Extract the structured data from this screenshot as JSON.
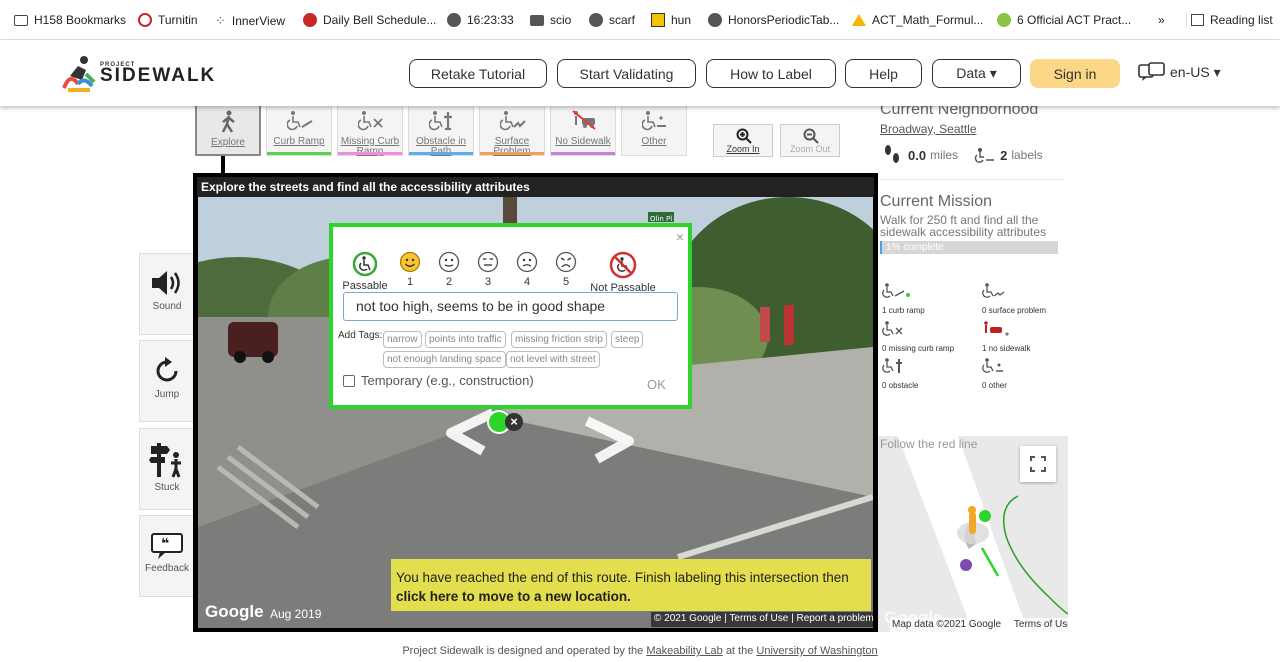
{
  "bookmarks": {
    "items": [
      {
        "label": "H158 Bookmarks",
        "icon": "folder-icon"
      },
      {
        "label": "Turnitin",
        "icon": "turnitin-icon"
      },
      {
        "label": "InnerView",
        "icon": "innerview-icon"
      },
      {
        "label": "Daily Bell Schedule...",
        "icon": "bell-schedule-icon"
      },
      {
        "label": "16:23:33",
        "icon": "globe-icon"
      },
      {
        "label": "scio",
        "icon": "folder-icon"
      },
      {
        "label": "scarf",
        "icon": "globe-icon"
      },
      {
        "label": "hun",
        "icon": "hun-icon"
      },
      {
        "label": "HonorsPeriodicTab...",
        "icon": "globe-icon"
      },
      {
        "label": "ACT_Math_Formul...",
        "icon": "drive-icon"
      },
      {
        "label": "6 Official ACT Pract...",
        "icon": "pdf-icon"
      }
    ],
    "overflow": "»",
    "reading_list": "Reading list"
  },
  "header": {
    "logo_small": "PROJECT",
    "logo_big": "SIDEWALK",
    "nav": [
      "Retake Tutorial",
      "Start Validating",
      "How to Label",
      "Help",
      "Data ▾"
    ],
    "sign_in": "Sign in",
    "language": "en-US ▾"
  },
  "toolbar": {
    "tools": [
      {
        "label": "Explore",
        "icon": "walking-person-icon",
        "color": "#888888"
      },
      {
        "label": "Curb Ramp",
        "icon": "curb-ramp-icon",
        "color": "#55d44a"
      },
      {
        "label": "Missing Curb Ramp",
        "icon": "missing-curb-ramp-icon",
        "color": "#f08de0"
      },
      {
        "label": "Obstacle in Path",
        "icon": "obstacle-icon",
        "color": "#58b0e8"
      },
      {
        "label": "Surface Problem",
        "icon": "surface-problem-icon",
        "color": "#f0a050"
      },
      {
        "label": "No Sidewalk",
        "icon": "no-sidewalk-icon",
        "color": "#c880e0"
      },
      {
        "label": "Other",
        "icon": "other-icon",
        "color": "#cccccc"
      }
    ],
    "zoom_in": "Zoom In",
    "zoom_out": "Zoom Out"
  },
  "side_buttons": [
    {
      "label": "Sound",
      "icon": "speaker-icon"
    },
    {
      "label": "Jump",
      "icon": "refresh-icon"
    },
    {
      "label": "Stuck",
      "icon": "signpost-icon"
    },
    {
      "label": "Feedback",
      "icon": "feedback-icon"
    }
  ],
  "panorama": {
    "header": "Explore the streets and find all the accessibility attributes",
    "google_logo": "Google",
    "date": "Aug 2019",
    "copyright": "© 2021 Google",
    "terms": "Terms of Use",
    "report": "Report a problem",
    "street_sign": "Olin Pl"
  },
  "severity_dialog": {
    "close": "×",
    "passable": "Passable",
    "not_passable": "Not Passable",
    "levels": [
      "1",
      "2",
      "3",
      "4",
      "5"
    ],
    "description": "not too high, seems to be in good shape",
    "add_tags_label": "Add Tags:",
    "tags": [
      "narrow",
      "points into traffic",
      "missing friction strip",
      "steep",
      "not enough landing space",
      "not level with street"
    ],
    "temporary_label": "Temporary (e.g., construction)",
    "ok": "OK"
  },
  "route_message": {
    "text": "You have reached the end of this route. Finish labeling this intersection then",
    "link": "click here to move to a new location."
  },
  "neighborhood": {
    "title": "Current Neighborhood",
    "name": "Broadway, Seattle",
    "miles": "0.0",
    "miles_unit": "miles",
    "labels": "2",
    "labels_unit": "labels"
  },
  "mission": {
    "title": "Current Mission",
    "description": "Walk for 250 ft and find all the sidewalk accessibility attributes",
    "progress_text": "1% complete",
    "progress": 1
  },
  "label_counts": [
    {
      "text": "1 curb ramp",
      "icon": "curb-ramp-icon"
    },
    {
      "text": "0 surface problem",
      "icon": "surface-problem-icon"
    },
    {
      "text": "0 missing curb ramp",
      "icon": "missing-curb-ramp-icon"
    },
    {
      "text": "1 no sidewalk",
      "icon": "no-sidewalk-icon"
    },
    {
      "text": "0 obstacle",
      "icon": "obstacle-icon"
    },
    {
      "text": "0 other",
      "icon": "other-icon"
    }
  ],
  "minimap": {
    "title": "Follow the red line",
    "map_data": "Map data ©2021 Google",
    "terms": "Terms of Use",
    "google_logo": "Google"
  },
  "footer": {
    "prefix": "Project Sidewalk is designed and operated by the",
    "lab": "Makeability Lab",
    "middle": "at the",
    "university": "University of Washington"
  }
}
